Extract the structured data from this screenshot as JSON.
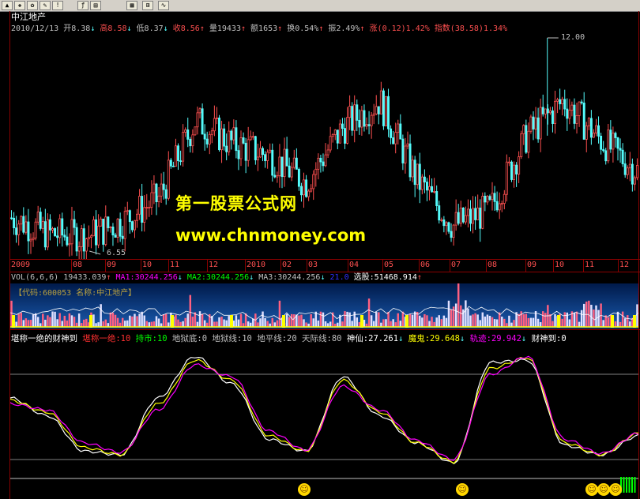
{
  "toolbar": {
    "icons": [
      "chart-icon",
      "tool-icon",
      "gear-icon",
      "tool-icon",
      "alert-icon",
      "formula-icon",
      "print-icon",
      "grid-icon",
      "zoom-icon"
    ]
  },
  "stock_title": "中江地产",
  "price_info": {
    "date": "2010/12/13",
    "open": "开8.38",
    "high": "高8.58",
    "low": "低8.37",
    "close": "收8.56",
    "volume": "量19433",
    "amount": "额1653",
    "turnover": "换0.54%",
    "amplitude": "振2.49%",
    "change": "涨(0.12)1.42%",
    "index": "指数(38.58)1.34%"
  },
  "annotations": {
    "max": "12.00",
    "min": "6.55"
  },
  "watermark": {
    "line1": "第一股票公式网",
    "line2": "www.chnmoney.com"
  },
  "time_axis": [
    "2009",
    "08",
    "09",
    "10",
    "11",
    "12",
    "2010",
    "02",
    "03",
    "04",
    "05",
    "06",
    "07",
    "08",
    "09",
    "10",
    "11",
    "12"
  ],
  "vol_header": {
    "label": "VOL(6,6,6)",
    "vol": "19433.039",
    "ma1": "MA1:30244.256",
    "ma2": "MA2:30244.256",
    "ma3": "MA3:30244.256",
    "extra": "21.0",
    "xuangu": "选股:51468.914"
  },
  "code_info": "【代码:600053  名称:中江地产】",
  "indicator": {
    "name": "堪称一绝的财神到",
    "p1": "堪称一绝:10",
    "p2": "持市:10",
    "p3": "地狱底:0",
    "p4": "地狱线:10",
    "p5": "地平线:20",
    "p6": "天际线:80",
    "p7": "神仙:27.261",
    "p8": "魔鬼:29.648",
    "p9": "轨迹:29.942",
    "p10": "财神到:0"
  },
  "colors": {
    "up": "#ff5050",
    "down": "#54fcfc",
    "yellow": "#ffff00",
    "magenta": "#ff00ff",
    "axis": "#8b0000",
    "green": "#00ff00"
  },
  "chart_data": [
    {
      "type": "candlestick",
      "title": "中江地产",
      "x": [
        "2009",
        "08",
        "09",
        "10",
        "11",
        "12",
        "2010",
        "02",
        "03",
        "04",
        "05",
        "06",
        "07",
        "08",
        "09",
        "10",
        "11",
        "12"
      ],
      "close_trend": [
        7.4,
        7.0,
        6.9,
        7.3,
        7.9,
        9.9,
        9.3,
        9.0,
        8.3,
        9.7,
        10.4,
        8.4,
        7.2,
        7.6,
        9.5,
        10.4,
        9.4,
        8.6
      ],
      "ylim": [
        6.55,
        12.0
      ]
    },
    {
      "type": "line",
      "title": "堪称一绝的财神到",
      "series": [
        {
          "name": "神仙",
          "values": [
            60,
            45,
            15,
            12,
            60,
            95,
            72,
            25,
            15,
            78,
            45,
            22,
            5,
            90,
            92,
            20,
            12,
            28
          ]
        },
        {
          "name": "魔鬼",
          "values": [
            58,
            48,
            18,
            12,
            55,
            92,
            75,
            28,
            15,
            75,
            48,
            22,
            6,
            85,
            94,
            22,
            12,
            30
          ]
        },
        {
          "name": "轨迹",
          "values": [
            55,
            50,
            22,
            14,
            50,
            88,
            78,
            32,
            16,
            70,
            50,
            24,
            8,
            80,
            95,
            25,
            13,
            30
          ]
        }
      ],
      "ylim": [
        0,
        100
      ]
    }
  ]
}
